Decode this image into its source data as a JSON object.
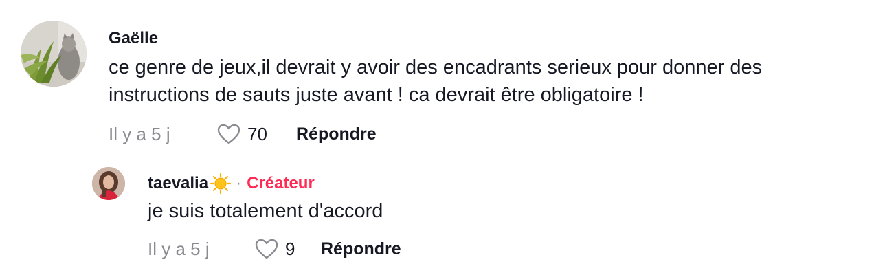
{
  "comments": [
    {
      "username": "Gaëlle",
      "text_line1": "ce genre de jeux,il devrait y avoir des encadrants serieux pour donner des",
      "text_line2": "instructions de sauts juste avant ! ca devrait être obligatoire !",
      "timestamp": "Il y a 5 j",
      "likes": "70",
      "reply_label": "Répondre",
      "avatar_icon": "plant-cat-photo-avatar"
    }
  ],
  "replies": [
    {
      "username": "taevalia",
      "username_emoji": "☀️",
      "separator": "·",
      "badge": "Créateur",
      "text": "je suis totalement d'accord",
      "timestamp": "Il y a 5 j",
      "likes": "9",
      "reply_label": "Répondre",
      "avatar_icon": "person-photo-avatar"
    }
  ],
  "colors": {
    "accent": "#fe2c55",
    "muted": "#8a8b91",
    "text": "#161823"
  }
}
